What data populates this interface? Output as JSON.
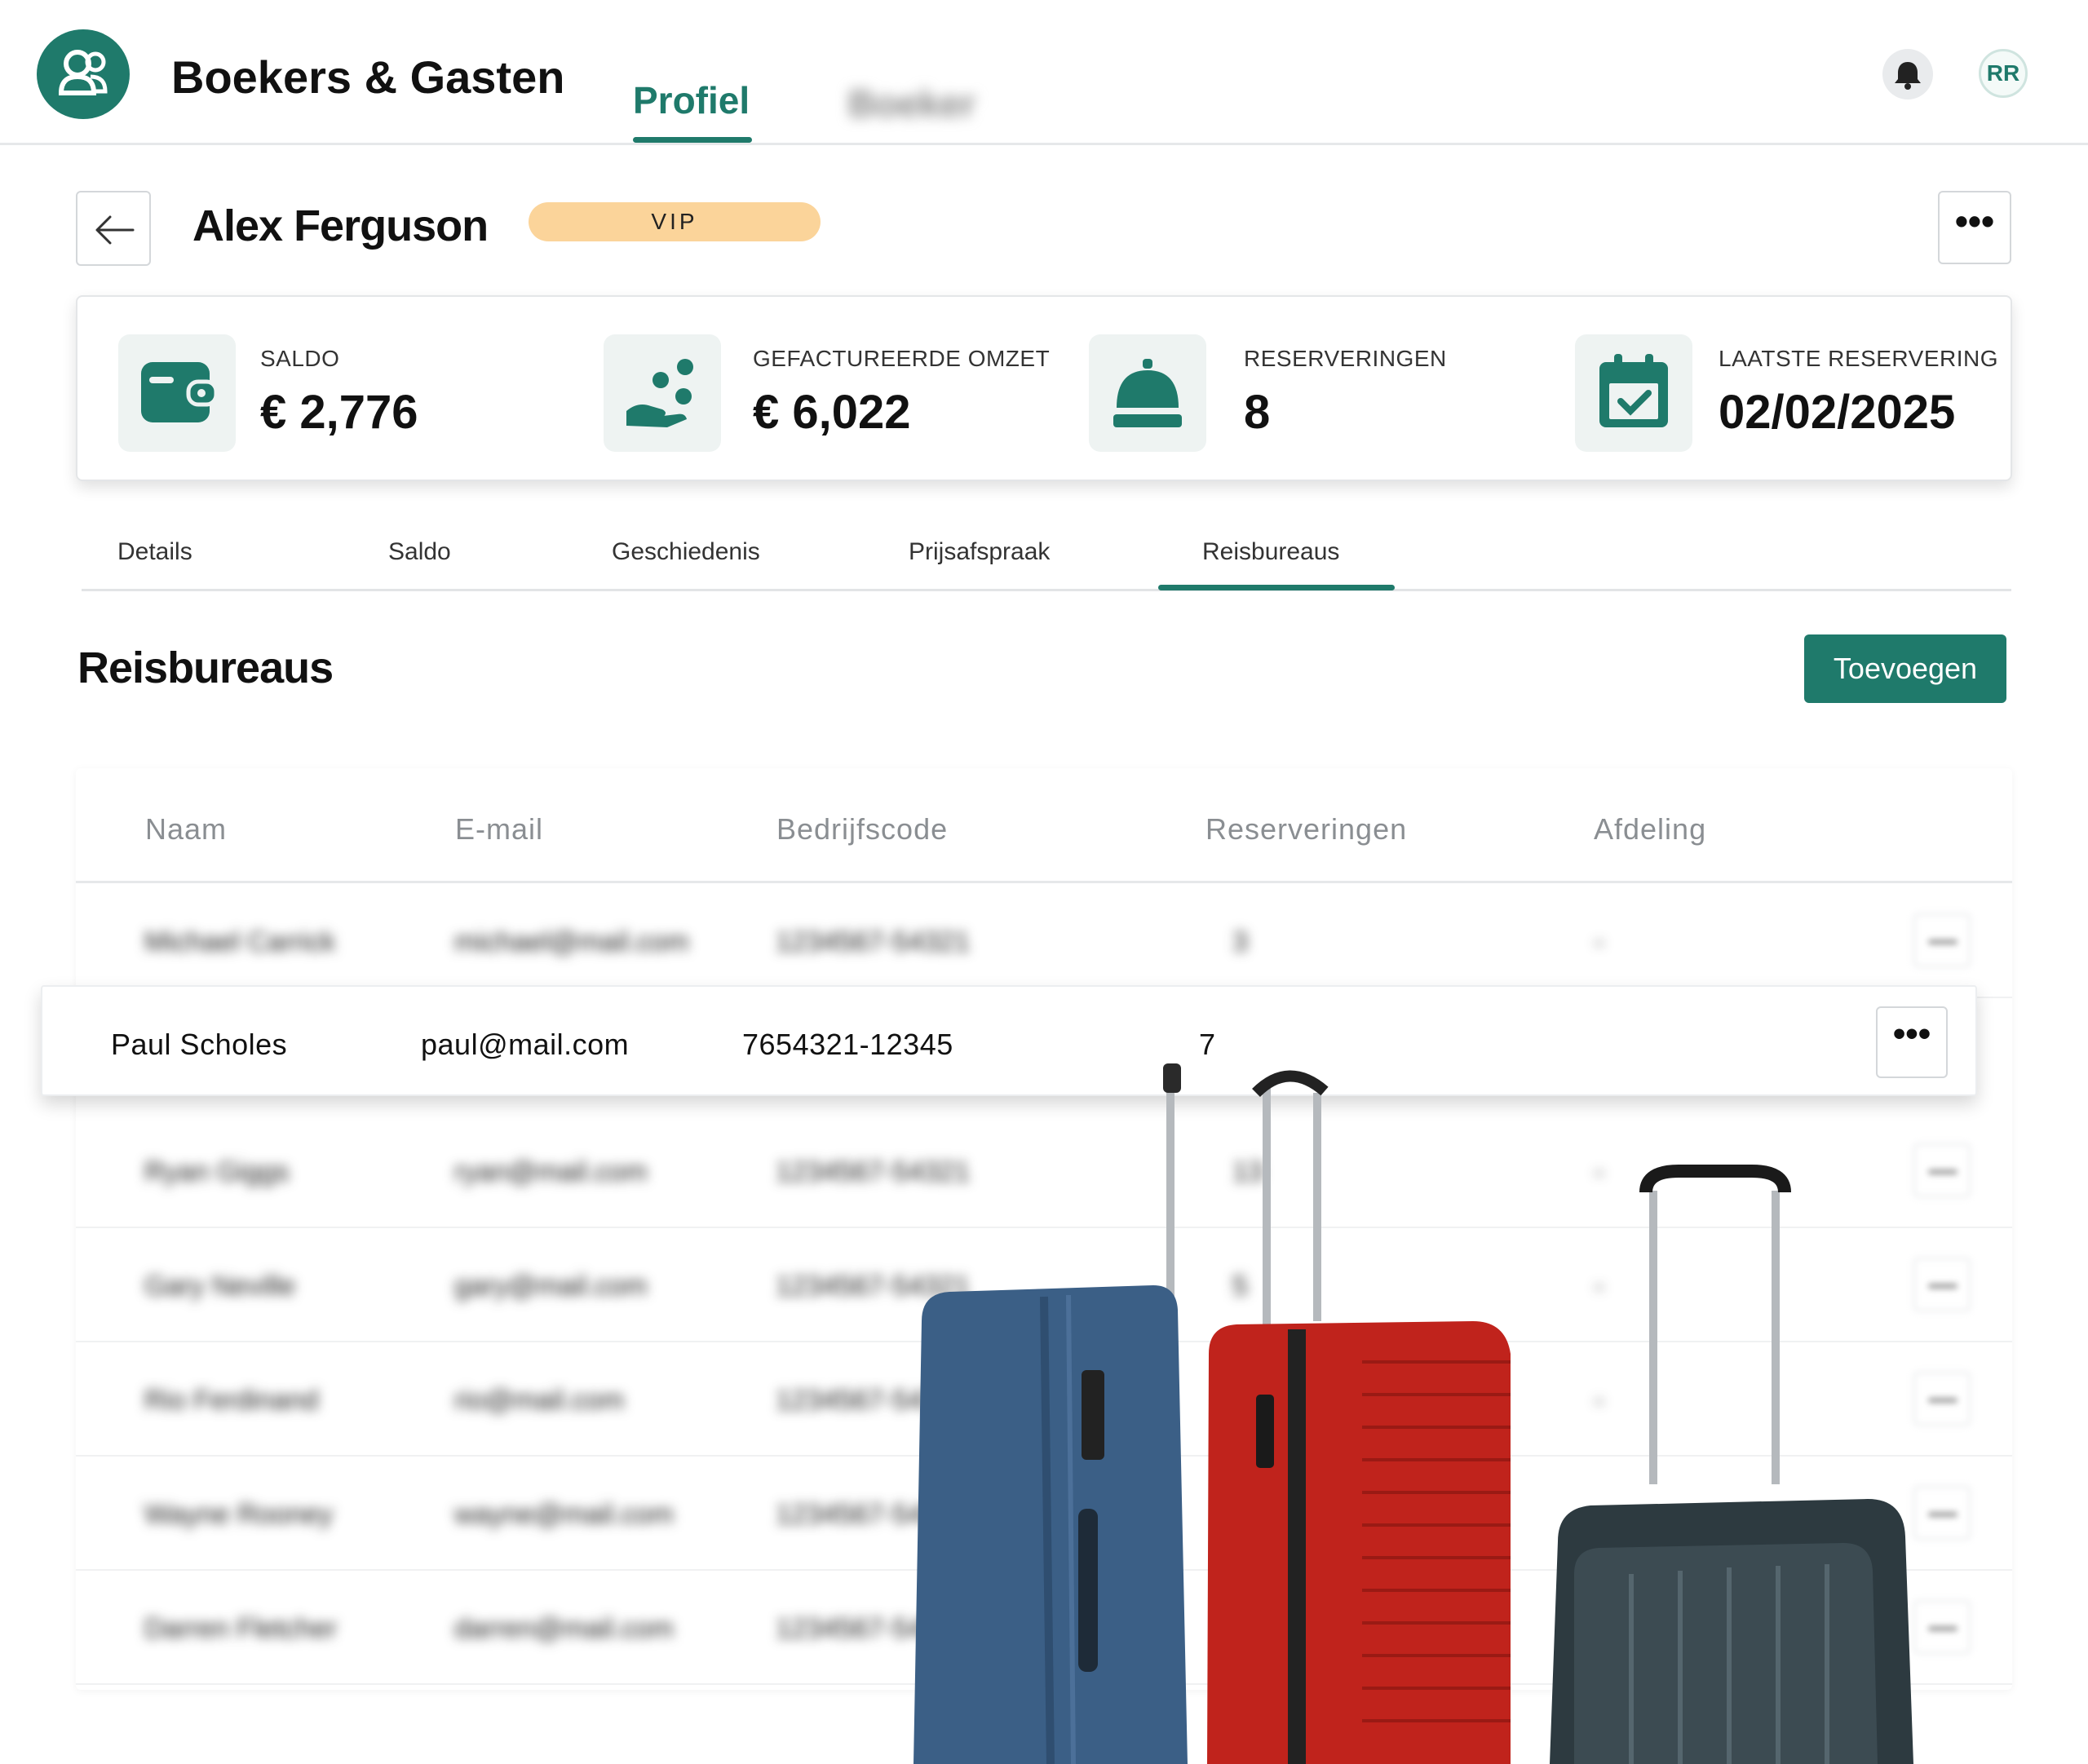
{
  "header": {
    "app_title": "Boekers & Gasten",
    "nav_active": "Profiel",
    "nav_blurred": "Boeker",
    "avatar_initials": "RR"
  },
  "profile": {
    "name": "Alex Ferguson",
    "badge": "VIP",
    "more": "•••"
  },
  "stats": [
    {
      "label": "SALDO",
      "value": "€ 2,776",
      "icon": "wallet-icon"
    },
    {
      "label": "GEFACTUREERDE OMZET",
      "value": "€ 6,022",
      "icon": "hand-coins-icon"
    },
    {
      "label": "RESERVERINGEN",
      "value": "8",
      "icon": "service-bell-icon"
    },
    {
      "label": "LAATSTE RESERVERING",
      "value": "02/02/2025",
      "icon": "calendar-check-icon"
    }
  ],
  "tabs": [
    "Details",
    "Saldo",
    "Geschiedenis",
    "Prijsafspraak",
    "Reisbureaus"
  ],
  "tab_active": "Reisbureaus",
  "section": {
    "title": "Reisbureaus",
    "add_label": "Toevoegen"
  },
  "table": {
    "headers": [
      "Naam",
      "E-mail",
      "Bedrijfscode",
      "Reserveringen",
      "Afdeling"
    ],
    "highlighted": {
      "name": "Paul Scholes",
      "email": "paul@mail.com",
      "code": "7654321-12345",
      "reservations": "7",
      "more": "•••"
    },
    "rows": [
      {
        "name": "Michael Carrick",
        "email": "michael@mail.com",
        "code": "1234567-54321",
        "reservations": "3",
        "dept": "-"
      },
      {
        "name": "Ryan Giggs",
        "email": "ryan@mail.com",
        "code": "1234567-54321",
        "reservations": "13",
        "dept": "-"
      },
      {
        "name": "Gary Neville",
        "email": "gary@mail.com",
        "code": "1234567-54321",
        "reservations": "5",
        "dept": "-"
      },
      {
        "name": "Rio Ferdinand",
        "email": "rio@mail.com",
        "code": "1234567-54321",
        "reservations": "",
        "dept": "-"
      },
      {
        "name": "Wayne Rooney",
        "email": "wayne@mail.com",
        "code": "1234567-54321",
        "reservations": "",
        "dept": ""
      },
      {
        "name": "Darren Fletcher",
        "email": "darren@mail.com",
        "code": "1234567-54321",
        "reservations": "",
        "dept": ""
      }
    ]
  },
  "colors": {
    "accent": "#1f7a6b",
    "badge": "#fbd49a",
    "suitcase_blue": "#3b5f86",
    "suitcase_red": "#c0231c",
    "suitcase_dark": "#2d3a40"
  }
}
